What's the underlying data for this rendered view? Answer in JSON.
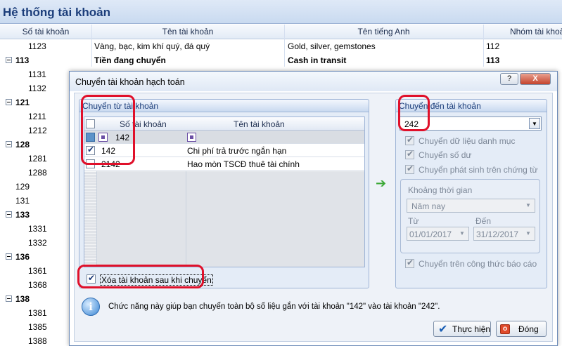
{
  "background": {
    "title": "Hệ thống tài khoản",
    "columns": [
      "Số tài khoản",
      "Tên tài khoản",
      "Tên tiếng Anh",
      "Nhóm tài khoản"
    ],
    "rows": [
      {
        "code": "1123",
        "name": "Vàng, bạc, kim khí quý, đá quý",
        "en": "Gold, silver, gemstones",
        "group": "112",
        "bold": false,
        "expander": false
      },
      {
        "code": "113",
        "name": "Tiền đang chuyển",
        "en": "Cash in transit",
        "group": "113",
        "bold": true,
        "expander": true
      },
      {
        "code": "1131",
        "bold": false,
        "expander": false
      },
      {
        "code": "1132",
        "bold": false,
        "expander": false
      },
      {
        "code": "121",
        "bold": true,
        "expander": true
      },
      {
        "code": "1211",
        "bold": false,
        "expander": false
      },
      {
        "code": "1212",
        "bold": false,
        "expander": false
      },
      {
        "code": "128",
        "bold": true,
        "expander": true
      },
      {
        "code": "1281",
        "bold": false,
        "expander": false
      },
      {
        "code": "1288",
        "bold": false,
        "expander": false
      },
      {
        "code": "129",
        "bold": false,
        "expander": false
      },
      {
        "code": "131",
        "bold": false,
        "expander": false
      },
      {
        "code": "133",
        "bold": true,
        "expander": true
      },
      {
        "code": "1331",
        "bold": false,
        "expander": false
      },
      {
        "code": "1332",
        "bold": false,
        "expander": false
      },
      {
        "code": "136",
        "bold": true,
        "expander": true
      },
      {
        "code": "1361",
        "bold": false,
        "expander": false
      },
      {
        "code": "1368",
        "bold": false,
        "expander": false
      },
      {
        "code": "138",
        "bold": true,
        "expander": true
      },
      {
        "code": "1381",
        "bold": false,
        "expander": false
      },
      {
        "code": "1385",
        "bold": false,
        "expander": false
      },
      {
        "code": "1388",
        "bold": false,
        "expander": false
      }
    ]
  },
  "dialog": {
    "title": "Chuyển tài khoản hạch toán",
    "help_label": "?",
    "close_label": "X",
    "from_group": {
      "title": "Chuyển từ tài khoản",
      "col_code": "Số tài khoản",
      "col_name": "Tên tài khoản",
      "filter_value": "142",
      "rows": [
        {
          "code": "142",
          "name": "Chi phí trả trước ngắn hạn",
          "checked": true
        },
        {
          "code": "2142",
          "name": "Hao mòn TSCĐ thuê tài chính",
          "checked": false
        }
      ],
      "delete_after_label": "Xóa tài khoản sau khi chuyển",
      "delete_after_checked": true
    },
    "to_group": {
      "title": "Chuyển đến tài khoản",
      "account_value": "242",
      "opt_catalog": "Chuyển dữ liệu danh mục",
      "opt_balance": "Chuyển số dư",
      "opt_vouchers": "Chuyển phát sinh trên chứng từ",
      "period_title": "Khoảng thời gian",
      "period_value": "Năm nay",
      "from_label": "Từ",
      "to_label": "Đến",
      "from_date": "01/01/2017",
      "to_date": "31/12/2017",
      "opt_formula": "Chuyển trên công thức báo cáo"
    },
    "info_text": "Chức năng này giúp bạn chuyển toàn bộ số liệu gắn với tài khoản \"142\" vào tài khoản \"242\".",
    "execute_label": "Thực hiện",
    "close_button_label": "Đóng"
  },
  "colors": {
    "highlight": "#e0102a",
    "accent": "#1b3d7a",
    "arrow": "#3aa835"
  }
}
